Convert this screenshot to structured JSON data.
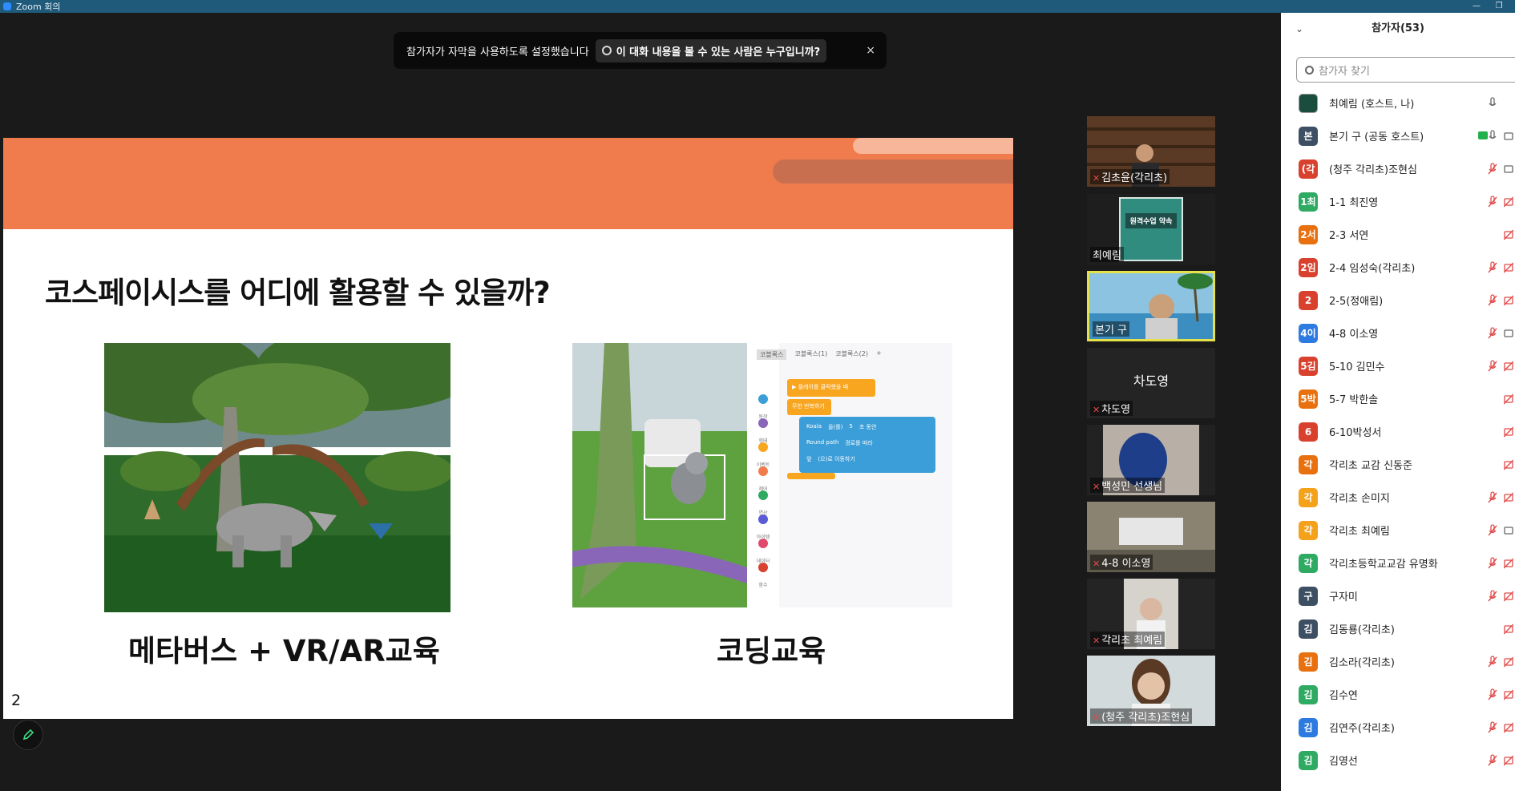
{
  "window": {
    "title": "Zoom 회의"
  },
  "banner": {
    "message": "참가자가 자막을 사용하도록 설정했습니다",
    "who_can_see": "이 대화 내용을 볼 수 있는 사람은 누구입니까?",
    "close": "×"
  },
  "slide": {
    "title": "코스페이시스를 어디에 활용할 수 있을까?",
    "left_caption": "메타버스 +  VR/AR교육",
    "right_caption": "코딩교육",
    "page_number": "2",
    "coding_ui": {
      "tabs": [
        "코블록스",
        "코블록스(1)",
        "코블록스(2)",
        "+"
      ],
      "block1": "▶ 플레이를 클릭했을 때",
      "block2": "무한 반복하기",
      "block3a": "Koala",
      "block3b": "을(를)",
      "block3c": "5",
      "block3d": "초 동안",
      "block4a": "Round path",
      "block4b": "경로를 따라",
      "block5a": "앞",
      "block5b": "(으)로 이동하기",
      "categories": [
        "동작",
        "형태",
        "이벤트",
        "제어",
        "연산",
        "아이템",
        "데이터",
        "함수"
      ]
    }
  },
  "tiles": [
    {
      "name": "김초윤(각리초)",
      "muted": true
    },
    {
      "name": "최예림",
      "muted": false,
      "poster_title": "원격수업 약속"
    },
    {
      "name": "본기 구",
      "muted": false,
      "active": true
    },
    {
      "name": "차도영",
      "muted": true,
      "big_name": "차도영"
    },
    {
      "name": "백성민 선생님",
      "muted": true
    },
    {
      "name": "4-8 이소영",
      "muted": true
    },
    {
      "name": "각리초 최예림",
      "muted": true
    },
    {
      "name": "(청주 각리초)조현심",
      "muted": true
    }
  ],
  "panel": {
    "header": "참가자(53)",
    "search_placeholder": "참가자 찾기",
    "participants": [
      {
        "avatar": "",
        "color": "#1b4d3e",
        "name": "최예림 (호스트, 나)",
        "mic": "on",
        "video": "none"
      },
      {
        "avatar": "본",
        "color": "#3d4f63",
        "name": "본기 구 (공동 호스트)",
        "mic": "on",
        "video": "on",
        "share": true
      },
      {
        "avatar": "(각",
        "color": "#d9412f",
        "name": "(청주 각리초)조현심",
        "mic": "muted",
        "video": "on"
      },
      {
        "avatar": "1최",
        "color": "#2eaa63",
        "name": "1-1 최진영",
        "mic": "muted",
        "video": "off"
      },
      {
        "avatar": "2서",
        "color": "#e9700e",
        "name": "2-3 서연",
        "mic": "none",
        "video": "off"
      },
      {
        "avatar": "2임",
        "color": "#d9412f",
        "name": "2-4 임성숙(각리초)",
        "mic": "muted",
        "video": "off"
      },
      {
        "avatar": "2",
        "color": "#d9412f",
        "name": "2-5(정애림)",
        "mic": "muted",
        "video": "off"
      },
      {
        "avatar": "4이",
        "color": "#2d7be0",
        "name": "4-8 이소영",
        "mic": "muted",
        "video": "on"
      },
      {
        "avatar": "5김",
        "color": "#d9412f",
        "name": "5-10 김민수",
        "mic": "muted",
        "video": "off"
      },
      {
        "avatar": "5박",
        "color": "#e9700e",
        "name": "5-7 박한솔",
        "mic": "none",
        "video": "off"
      },
      {
        "avatar": "6",
        "color": "#d9412f",
        "name": "6-10박성서",
        "mic": "none",
        "video": "off"
      },
      {
        "avatar": "각",
        "color": "#e9700e",
        "name": "각리초  교감 신동준",
        "mic": "none",
        "video": "off"
      },
      {
        "avatar": "각",
        "color": "#f4a11c",
        "name": "각리초 손미지",
        "mic": "muted",
        "video": "off"
      },
      {
        "avatar": "각",
        "color": "#f4a11c",
        "name": "각리초 최예림",
        "mic": "muted",
        "video": "on"
      },
      {
        "avatar": "각",
        "color": "#2eaa63",
        "name": "각리초등학교교감 유명화",
        "mic": "muted",
        "video": "off"
      },
      {
        "avatar": "구",
        "color": "#3d4f63",
        "name": "구자미",
        "mic": "muted",
        "video": "off"
      },
      {
        "avatar": "김",
        "color": "#3d4f63",
        "name": "김동룡(각리초)",
        "mic": "none",
        "video": "off"
      },
      {
        "avatar": "김",
        "color": "#e9700e",
        "name": "김소라(각리초)",
        "mic": "muted",
        "video": "off"
      },
      {
        "avatar": "김",
        "color": "#2eaa63",
        "name": "김수연",
        "mic": "muted",
        "video": "off"
      },
      {
        "avatar": "김",
        "color": "#2d7be0",
        "name": "김연주(각리초)",
        "mic": "muted",
        "video": "off"
      },
      {
        "avatar": "김",
        "color": "#2eaa63",
        "name": "김영선",
        "mic": "muted",
        "video": "off"
      }
    ]
  },
  "colors": {
    "accent": "#f07b4c",
    "zoom_blue": "#2d8cff",
    "muted_red": "#e04b4b"
  }
}
